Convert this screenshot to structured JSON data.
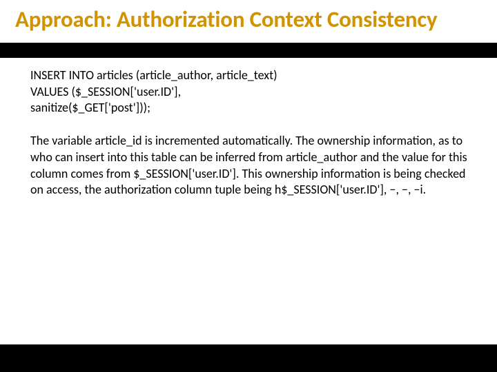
{
  "title": "Approach: Authorization Context Consistency",
  "code_line1": "INSERT INTO articles (article_author, article_text)",
  "code_line2": "VALUES ($_SESSION['user.ID'],",
  "code_line3": "sanitize($_GET['post']));",
  "paragraph": "The variable article_id is incremented automatically. The ownership information, as to who can insert into this table can be inferred from article_author and the value for this column comes from $_SESSION['user.ID']. This ownership information is being checked on access, the authorization column tuple being h$_SESSION['user.ID'], −, −, −i."
}
